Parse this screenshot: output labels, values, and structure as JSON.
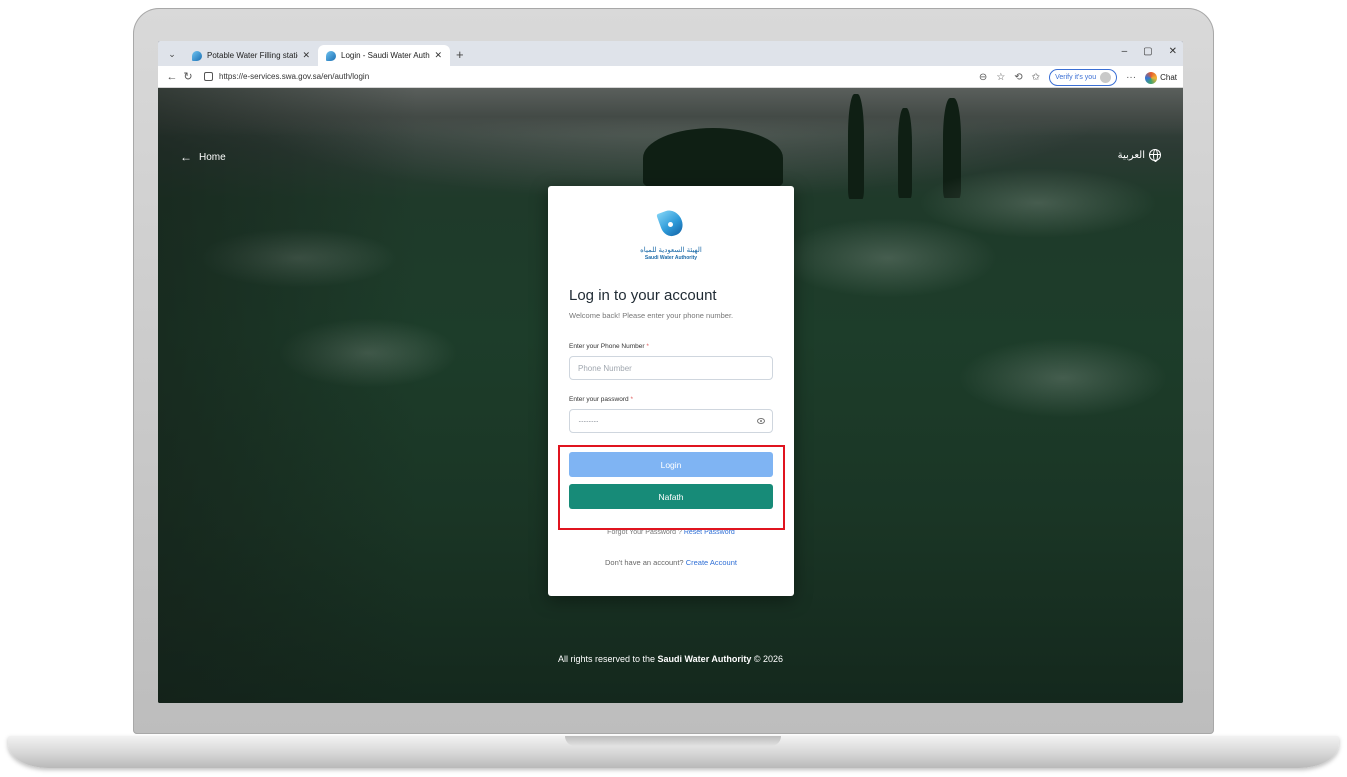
{
  "browser": {
    "tabs": [
      {
        "title": "Potable Water Filling station (Prod",
        "active": false
      },
      {
        "title": "Login - Saudi Water Authority",
        "active": true
      }
    ],
    "new_tab_glyph": "+",
    "url": "https://e-services.swa.gov.sa/en/auth/login",
    "verify_label": "Verify it's you",
    "more_glyph": "···",
    "chat_label": "Chat",
    "window_controls": [
      "–",
      "▢",
      "✕"
    ]
  },
  "page": {
    "home_label": "Home",
    "language_label": "العربية",
    "brand": {
      "name_ar": "الهيئة السعودية للمياه",
      "name_en": "Saudi Water Authority"
    },
    "title": "Log in to your account",
    "subtitle": "Welcome back! Please enter your phone number.",
    "phone": {
      "label": "Enter your Phone Number",
      "required_mark": "*",
      "placeholder": "Phone Number",
      "value": ""
    },
    "password": {
      "label": "Enter your password",
      "required_mark": "*",
      "value_mask": "············"
    },
    "login_button": "Login",
    "nafath_button": "Nafath",
    "forgot_text": "Forgot Your Password ?",
    "reset_link": "Reset Password",
    "no_account_text": "Don't have an account?",
    "create_link": "Create Account",
    "footer": {
      "prefix": "All rights reserved to the",
      "org": "Saudi Water Authority",
      "suffix": "© 2026"
    }
  },
  "colors": {
    "login_button": "#7fb4f3",
    "nafath_button": "#178b78",
    "highlight_border": "#e0141f",
    "link": "#2f6fd6"
  }
}
